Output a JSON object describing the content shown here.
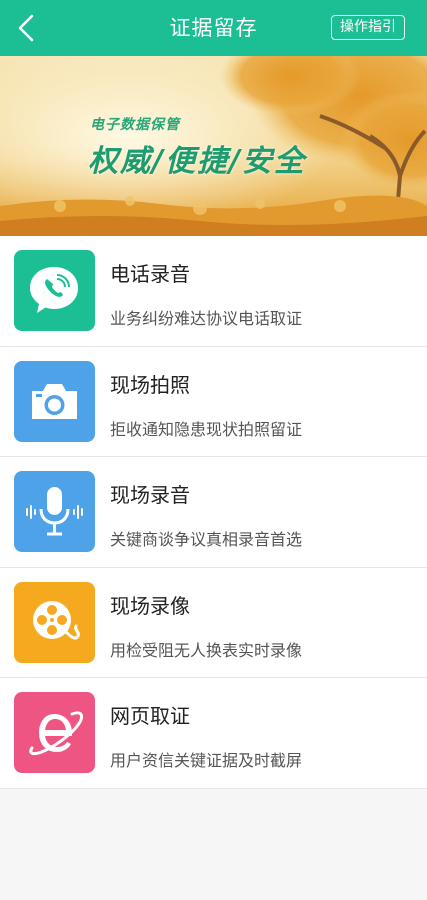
{
  "header": {
    "title": "证据留存",
    "guide_label": "操作指引",
    "back_icon": "chevron-left-icon"
  },
  "banner": {
    "subtitle": "电子数据保管",
    "headline": "权威/便捷/安全"
  },
  "items": [
    {
      "title": "电话录音",
      "desc": "业务纠纷难达协议电话取证",
      "icon": "phone-bubble-icon",
      "color": "#1cbf93"
    },
    {
      "title": "现场拍照",
      "desc": "拒收通知隐患现状拍照留证",
      "icon": "camera-icon",
      "color": "#4ea3e8"
    },
    {
      "title": "现场录音",
      "desc": "关键商谈争议真相录音首选",
      "icon": "microphone-icon",
      "color": "#4ea3e8"
    },
    {
      "title": "现场录像",
      "desc": "用检受阻无人换表实时录像",
      "icon": "film-reel-icon",
      "color": "#f5a91e"
    },
    {
      "title": "网页取证",
      "desc": "用户资信关键证据及时截屏",
      "icon": "browser-e-icon",
      "color": "#ee5583"
    }
  ],
  "colors": {
    "primary": "#1cbf93",
    "blue": "#4ea3e8",
    "orange": "#f5a91e",
    "pink": "#ee5583"
  }
}
